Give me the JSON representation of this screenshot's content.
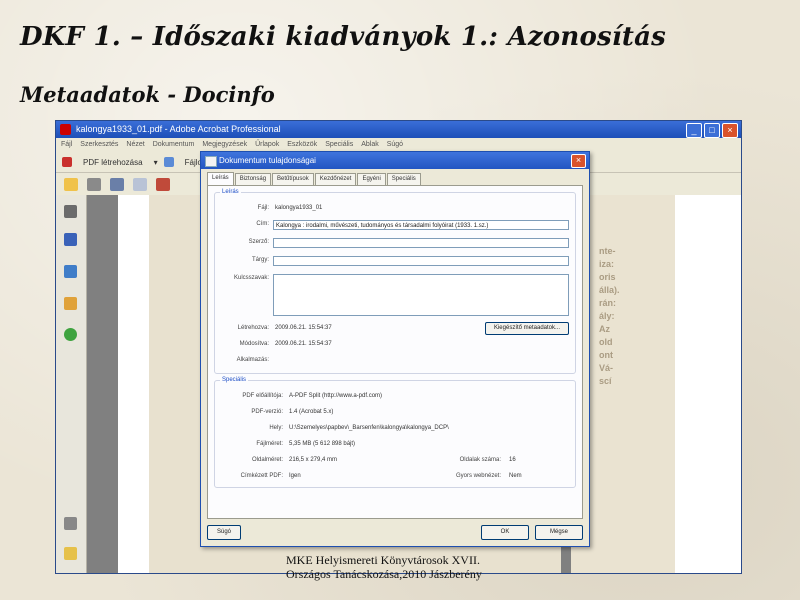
{
  "slide": {
    "title": "DKF 1. – Időszaki kiadványok 1.: Azonosítás",
    "subtitle": "Metaadatok - Docinfo",
    "footer_line1": "MKE Helyismereti Könyvtárosok XVII.",
    "footer_line2": "Országos Tanácskozása,2010 Jászberény"
  },
  "app": {
    "window_title": "kalongya1933_01.pdf - Adobe Acrobat Professional",
    "menu": [
      "Fájl",
      "Szerkesztés",
      "Nézet",
      "Dokumentum",
      "Megjegyzések",
      "Űrlapok",
      "Eszközök",
      "Speciális",
      "Ablak",
      "Súgó"
    ],
    "toolbar_btn1": "PDF létrehozása",
    "toolbar_btn2": "Fájlo kom",
    "right_text": [
      "nte-",
      "iza:",
      "oris",
      "álla).",
      "rán:",
      "ály:",
      "Az",
      "",
      "old",
      "ont",
      "",
      "",
      "",
      "Vá-",
      "scí"
    ]
  },
  "dialog": {
    "title": "Dokumentum tulajdonságai",
    "tabs": [
      "Leírás",
      "Biztonság",
      "Betűtípusok",
      "Kezdőnézet",
      "Egyéni",
      "Speciális"
    ],
    "description_legend": "Leírás",
    "fields": {
      "file_label": "Fájl:",
      "file_value": "kalongya1933_01",
      "title_label": "Cím:",
      "title_value": "Kalongya : irodalmi, művészeti, tudományos és társadalmi folyóirat (1933. 1.sz.)",
      "author_label": "Szerző:",
      "subject_label": "Tárgy:",
      "keywords_label": "Kulcsszavak:",
      "created_label": "Létrehozva:",
      "created_value": "2009.06.21. 15:54:37",
      "modified_label": "Módosítva:",
      "modified_value": "2009.06.21. 15:54:37",
      "app_label": "Alkalmazás:",
      "meta_button": "Kiegészítő metaadatok..."
    },
    "advanced_legend": "Speciális",
    "advanced": {
      "producer_label": "PDF előállítója:",
      "producer_value": "A-PDF Split (http://www.a-pdf.com)",
      "version_label": "PDF-verzió:",
      "version_value": "1.4 (Acrobat 5.x)",
      "location_label": "Hely:",
      "location_value": "U:\\Szemelyes\\papbev\\_Barsenfen\\kalongya\\kalongya_DCP\\",
      "size_label": "Fájlméret:",
      "size_value": "5,35 MB (5 612 898 bájt)",
      "pagesize_label": "Oldalméret:",
      "pagesize_value": "216,5 x 279,4 mm",
      "pages_label": "Oldalak száma:",
      "pages_value": "16",
      "tagged_label": "Címkézett PDF:",
      "tagged_value": "Igen",
      "fastweb_label": "Gyors webnézet:",
      "fastweb_value": "Nem"
    },
    "help_button": "Súgó",
    "ok_button": "OK",
    "cancel_button": "Mégse"
  }
}
